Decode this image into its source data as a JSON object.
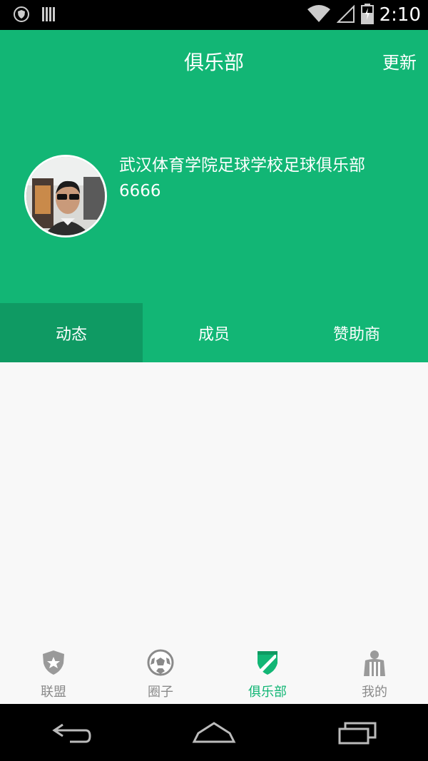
{
  "status_bar": {
    "time": "2:10",
    "icons": [
      "shield-icon",
      "barcode-icon",
      "wifi-icon",
      "signal-icon",
      "battery-icon"
    ]
  },
  "header": {
    "title": "俱乐部",
    "update_label": "更新",
    "club_name": "武汉体育学院足球学校足球俱乐部",
    "club_id": "6666",
    "colors": {
      "primary": "#12b675",
      "active_tab": "#0f9a63"
    }
  },
  "tabs": [
    {
      "label": "动态",
      "active": true
    },
    {
      "label": "成员",
      "active": false
    },
    {
      "label": "赞助商",
      "active": false
    }
  ],
  "bottom_nav": [
    {
      "label": "联盟",
      "icon": "shield-star-icon",
      "active": false
    },
    {
      "label": "圈子",
      "icon": "soccer-ball-icon",
      "active": false
    },
    {
      "label": "俱乐部",
      "icon": "club-badge-icon",
      "active": true
    },
    {
      "label": "我的",
      "icon": "player-icon",
      "active": false
    }
  ],
  "system_nav": [
    "back-icon",
    "home-icon",
    "recents-icon"
  ]
}
